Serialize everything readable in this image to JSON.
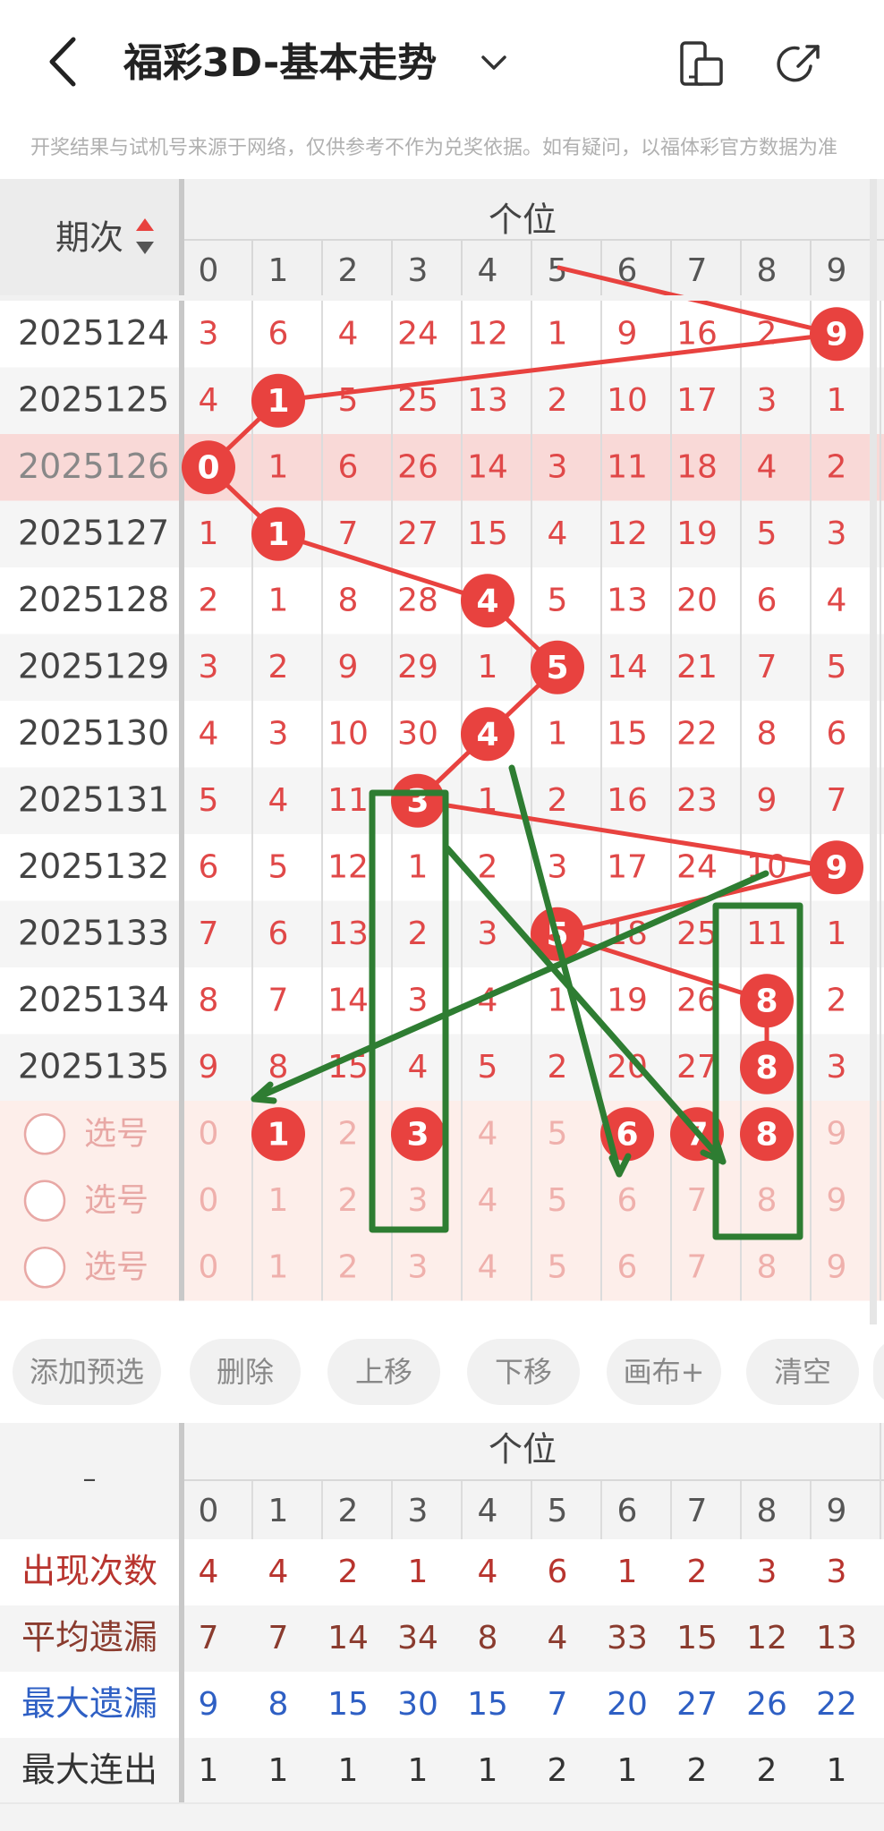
{
  "header": {
    "title": "福彩3D-基本走势",
    "notice": "开奖结果与试机号来源于网络，仅供参考不作为兑奖依据。如有疑问，以福体彩官方数据为准"
  },
  "table": {
    "section_label": "个位",
    "period_label": "期次",
    "digits": [
      "0",
      "1",
      "2",
      "3",
      "4",
      "5",
      "6",
      "7",
      "8",
      "9"
    ],
    "rows": [
      {
        "period": "2025124",
        "cells": [
          "3",
          "6",
          "4",
          "24",
          "12",
          "1",
          "9",
          "16",
          "2",
          "9"
        ],
        "hit": 9,
        "highlight": false
      },
      {
        "period": "2025125",
        "cells": [
          "4",
          "1",
          "5",
          "25",
          "13",
          "2",
          "10",
          "17",
          "3",
          "1"
        ],
        "hit": 1,
        "highlight": false
      },
      {
        "period": "2025126",
        "cells": [
          "0",
          "1",
          "6",
          "26",
          "14",
          "3",
          "11",
          "18",
          "4",
          "2"
        ],
        "hit": 0,
        "highlight": true
      },
      {
        "period": "2025127",
        "cells": [
          "1",
          "1",
          "7",
          "27",
          "15",
          "4",
          "12",
          "19",
          "5",
          "3"
        ],
        "hit": 1,
        "highlight": false
      },
      {
        "period": "2025128",
        "cells": [
          "2",
          "1",
          "8",
          "28",
          "4",
          "5",
          "13",
          "20",
          "6",
          "4"
        ],
        "hit": 4,
        "highlight": false
      },
      {
        "period": "2025129",
        "cells": [
          "3",
          "2",
          "9",
          "29",
          "1",
          "5",
          "14",
          "21",
          "7",
          "5"
        ],
        "hit": 5,
        "highlight": false
      },
      {
        "period": "2025130",
        "cells": [
          "4",
          "3",
          "10",
          "30",
          "4",
          "1",
          "15",
          "22",
          "8",
          "6"
        ],
        "hit": 4,
        "highlight": false
      },
      {
        "period": "2025131",
        "cells": [
          "5",
          "4",
          "11",
          "3",
          "1",
          "2",
          "16",
          "23",
          "9",
          "7"
        ],
        "hit": 3,
        "highlight": false
      },
      {
        "period": "2025132",
        "cells": [
          "6",
          "5",
          "12",
          "1",
          "2",
          "3",
          "17",
          "24",
          "10",
          "9"
        ],
        "hit": 9,
        "highlight": false
      },
      {
        "period": "2025133",
        "cells": [
          "7",
          "6",
          "13",
          "2",
          "3",
          "5",
          "18",
          "25",
          "11",
          "1"
        ],
        "hit": 5,
        "highlight": false
      },
      {
        "period": "2025134",
        "cells": [
          "8",
          "7",
          "14",
          "3",
          "4",
          "1",
          "19",
          "26",
          "8",
          "2"
        ],
        "hit": 8,
        "highlight": false
      },
      {
        "period": "2025135",
        "cells": [
          "9",
          "8",
          "15",
          "4",
          "5",
          "2",
          "20",
          "27",
          "8",
          "3"
        ],
        "hit": 8,
        "highlight": false
      }
    ],
    "pick_label": "选号",
    "picks": [
      {
        "selected": [
          1,
          3,
          6,
          7,
          8
        ]
      },
      {
        "selected": []
      },
      {
        "selected": []
      }
    ]
  },
  "buttons": [
    "添加预选",
    "删除",
    "上移",
    "下移",
    "画布+",
    "清空"
  ],
  "stats": {
    "section_label": "个位",
    "corner_label": "–",
    "rows": [
      {
        "label": "出现次数",
        "values": [
          "4",
          "4",
          "2",
          "1",
          "4",
          "6",
          "1",
          "2",
          "3",
          "3"
        ],
        "color": "#b8342e"
      },
      {
        "label": "平均遗漏",
        "values": [
          "7",
          "7",
          "14",
          "34",
          "8",
          "4",
          "33",
          "15",
          "12",
          "13"
        ],
        "color": "#8a3b2e"
      },
      {
        "label": "最大遗漏",
        "values": [
          "9",
          "8",
          "15",
          "30",
          "15",
          "7",
          "20",
          "27",
          "26",
          "22"
        ],
        "color": "#2e5fc4"
      },
      {
        "label": "最大连出",
        "values": [
          "1",
          "1",
          "1",
          "1",
          "1",
          "2",
          "1",
          "2",
          "2",
          "1"
        ],
        "color": "#333333"
      }
    ]
  },
  "colors": {
    "accent": "#e8423f",
    "overlay": "#2e7d32",
    "pick_bg": "#fdeeea"
  }
}
